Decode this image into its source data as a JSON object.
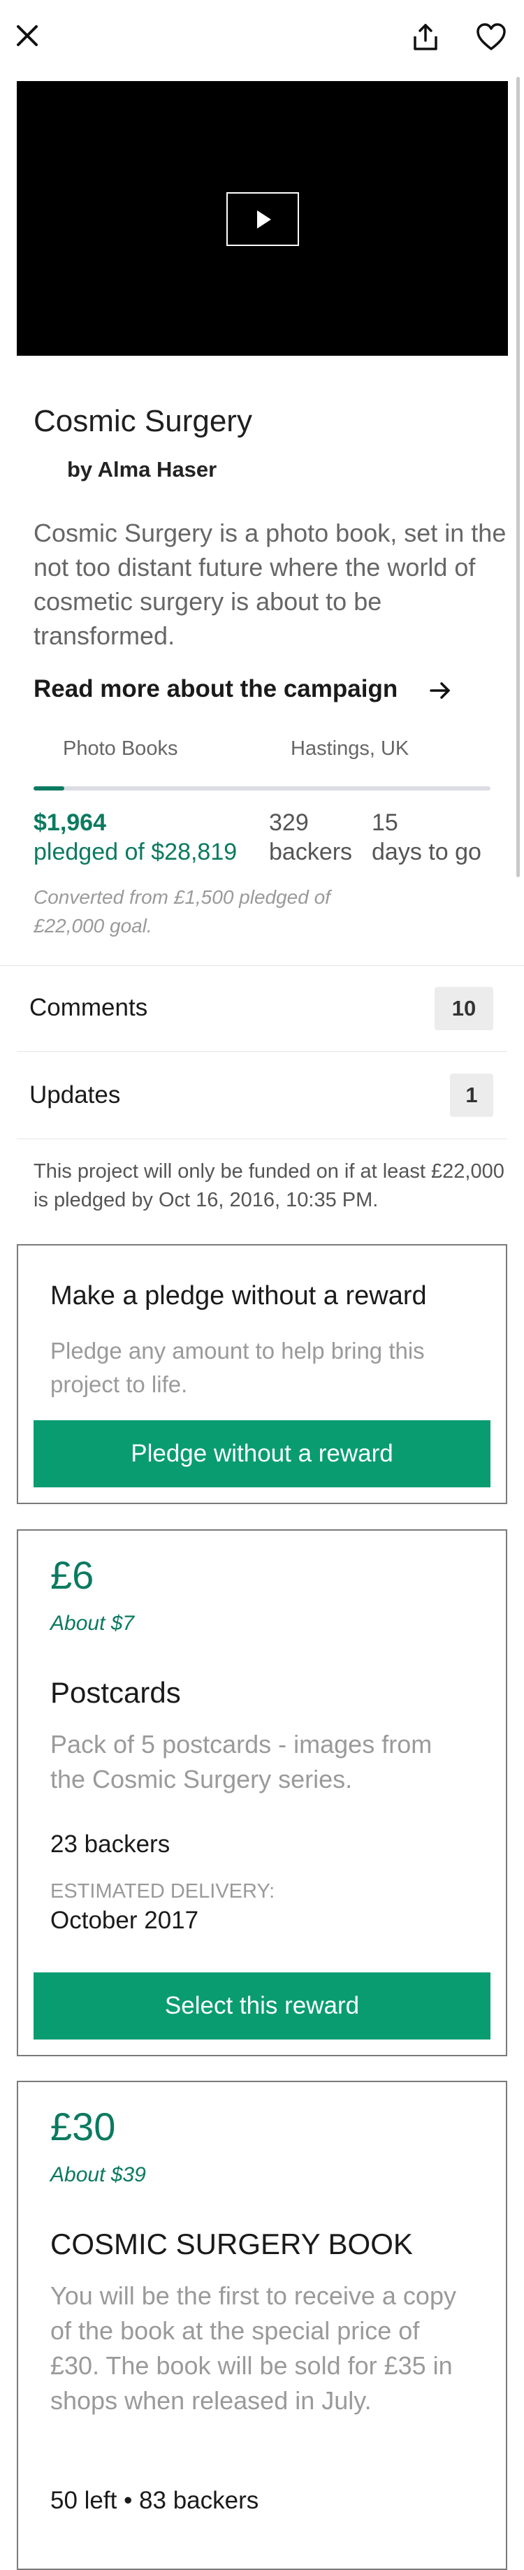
{
  "project": {
    "title": "Cosmic Surgery",
    "byline": "by Alma Haser",
    "blurb": "Cosmic Surgery is a photo book, set in the not too distant future where the world of cosmetic surgery is about to be transformed.",
    "read_more": "Read more about the campaign",
    "category": "Photo Books",
    "location": "Hastings, UK",
    "funded_fraction": 0.068
  },
  "stats": {
    "pledged_amount": "$1,964",
    "pledged_of": "pledged of $28,819",
    "backers_count": "329",
    "backers_label": "backers",
    "days_count": "15",
    "days_label": "days to go",
    "converted_note": "Converted from £1,500 pledged of £22,000 goal."
  },
  "rows": {
    "comments_label": "Comments",
    "comments_count": "10",
    "updates_label": "Updates",
    "updates_count": "1"
  },
  "funding_note": "This project will only be funded on if at least £22,000 is pledged by Oct 16, 2016, 10:35 PM.",
  "no_reward": {
    "heading": "Make a pledge without a reward",
    "description": "Pledge any amount to help bring this project to life.",
    "button": "Pledge without a reward"
  },
  "rewards": [
    {
      "price": "£6",
      "about": "About $7",
      "title": "Postcards",
      "description": "Pack of 5 postcards - images from the Cosmic Surgery series.",
      "backers": "23 backers",
      "delivery_label": "ESTIMATED DELIVERY:",
      "delivery_date": "October 2017",
      "button": "Select this reward"
    },
    {
      "price": "£30",
      "about": "About $39",
      "title": "COSMIC SURGERY BOOK",
      "description": "You will be the first to receive a copy of the book at the special price of £30. The book will be sold for £35 in shops when released in July.",
      "availability": "50 left • 83 backers"
    }
  ],
  "colors": {
    "accent_green": "#0b7a60",
    "button_green": "#099c71",
    "video_bg": "#000000"
  },
  "icons": {
    "close": "close-icon",
    "share": "share-icon",
    "favorite": "heart-icon",
    "play": "play-icon",
    "read_more": "arrow-right-icon"
  }
}
